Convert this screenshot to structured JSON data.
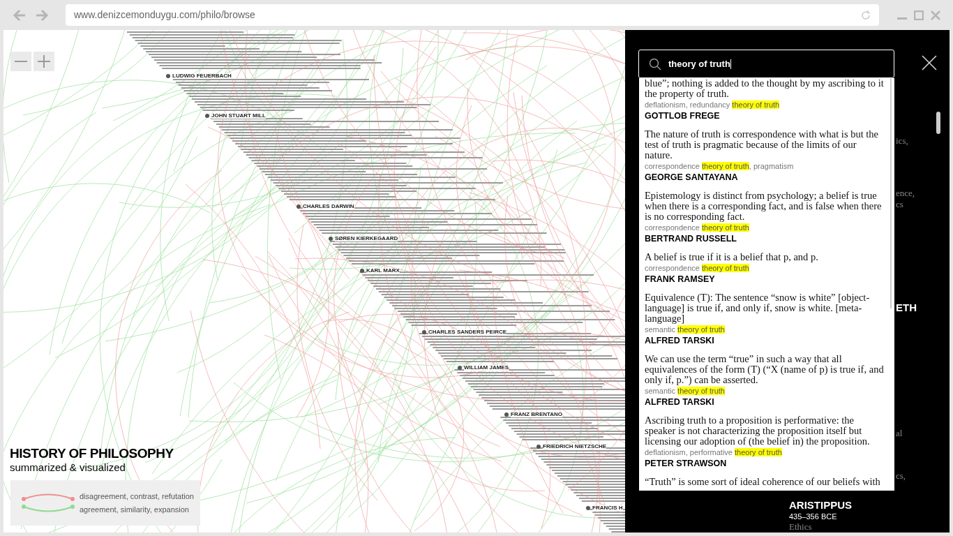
{
  "browser": {
    "url": "www.denizcemonduygu.com/philo/browse"
  },
  "map": {
    "philosophers": [
      "LUDWIG FEUERBACH",
      "JOHN STUART MILL",
      "CHARLES DARWIN",
      "SØREN KIERKEGAARD",
      "KARL MARX",
      "CHARLES SANDERS PEIRCE",
      "WILLIAM JAMES",
      "FRANZ BRENTANO",
      "FRIEDRICH NIETZSCHE",
      "FRANCIS H"
    ],
    "title": "HISTORY OF PHILOSOPHY",
    "subtitle": "summarized & visualized",
    "legend": [
      {
        "label": "disagreement, contrast, refutation",
        "color": "#ef8f8f"
      },
      {
        "label": "agreement, similarity, expansion",
        "color": "#8fdc8f"
      }
    ]
  },
  "panel": {
    "background_fragments": [
      {
        "text": "ics,",
        "kind": "plain"
      },
      {
        "text": "ence,",
        "kind": "plain"
      },
      {
        "text": "cs",
        "kind": "plain"
      },
      {
        "text": "ETH",
        "kind": "name"
      },
      {
        "text": "al",
        "kind": "plain"
      },
      {
        "text": "cs,",
        "kind": "plain"
      }
    ],
    "philosopher": {
      "name": "ARISTIPPUS",
      "years": "435–356 BCE",
      "field": "Ethics"
    }
  },
  "search": {
    "value": "theory of truth"
  },
  "results": [
    {
      "quote": "blue”; nothing is added to the thought by my ascribing to it the property of truth.",
      "tags": [
        {
          "text": "deflationism, redundancy ",
          "highlight": false
        },
        {
          "text": "theory of truth",
          "highlight": true
        }
      ],
      "author": "GOTTLOB FREGE"
    },
    {
      "quote": "The nature of truth is correspondence with what is but the test of truth is pragmatic because of the limits of our nature.",
      "tags": [
        {
          "text": "correspondence ",
          "highlight": false
        },
        {
          "text": "theory of truth",
          "highlight": true
        },
        {
          "text": ", pragmatism",
          "highlight": false
        }
      ],
      "author": "GEORGE SANTAYANA"
    },
    {
      "quote": "Epistemology is distinct from psychology; a belief is true when there is a corresponding fact, and is false when there is no corresponding fact.",
      "tags": [
        {
          "text": "correspondence ",
          "highlight": false
        },
        {
          "text": "theory of truth",
          "highlight": true
        }
      ],
      "author": "BERTRAND RUSSELL"
    },
    {
      "quote": "A belief is true if it is a belief that p, and p.",
      "tags": [
        {
          "text": "correspondence ",
          "highlight": false
        },
        {
          "text": "theory of truth",
          "highlight": true
        }
      ],
      "author": "FRANK RAMSEY"
    },
    {
      "quote": "Equivalence (T): The sentence “snow is white” [object-language] is true if, and only if, snow is white. [meta-language]",
      "tags": [
        {
          "text": "semantic ",
          "highlight": false
        },
        {
          "text": "theory of truth",
          "highlight": true
        }
      ],
      "author": "ALFRED TARSKI"
    },
    {
      "quote": "We can use the term “true” in such a way that all equivalences of the form (T) (“X (name of p) is true if, and only if, p.”) can be asserted.",
      "tags": [
        {
          "text": "semantic ",
          "highlight": false
        },
        {
          "text": "theory of truth",
          "highlight": true
        }
      ],
      "author": "ALFRED TARSKI"
    },
    {
      "quote": "Ascribing truth to a proposition is performative: the speaker is not characterizing the proposition itself but licensing our adoption of (the belief in) the proposition.",
      "tags": [
        {
          "text": "deflationism, performative ",
          "highlight": false
        },
        {
          "text": "theory of truth",
          "highlight": true
        }
      ],
      "author": "PETER STRAWSON"
    },
    {
      "quote": "“Truth” is some sort of ideal coherence of our beliefs with"
    }
  ]
}
